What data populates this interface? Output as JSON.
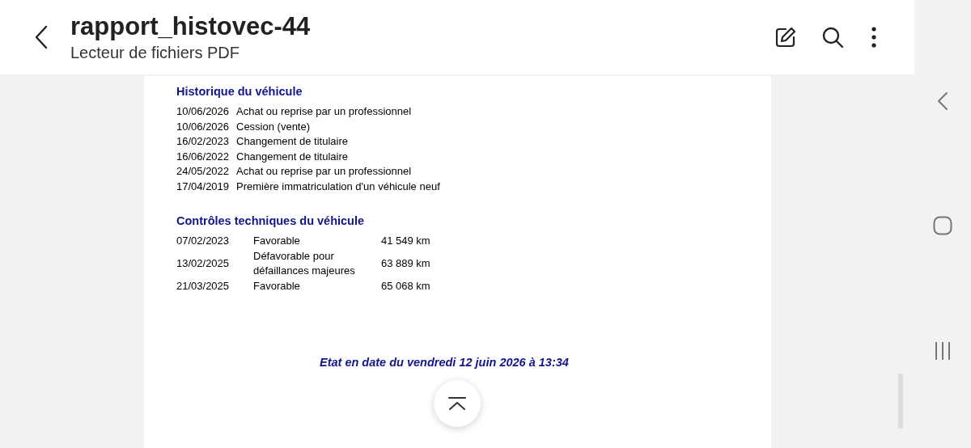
{
  "header": {
    "title": "rapport_histovec-44",
    "subtitle": "Lecteur de fichiers PDF"
  },
  "document": {
    "history": {
      "heading": "Historique du véhicule",
      "rows": [
        {
          "date": "10/06/2026",
          "event": "Achat ou reprise par un professionnel"
        },
        {
          "date": "10/06/2026",
          "event": "Cession (vente)"
        },
        {
          "date": "16/02/2023",
          "event": "Changement de titulaire"
        },
        {
          "date": "16/06/2022",
          "event": "Changement de titulaire"
        },
        {
          "date": "24/05/2022",
          "event": "Achat ou reprise par un professionnel"
        },
        {
          "date": "17/04/2019",
          "event": "Première immatriculation d'un véhicule neuf"
        }
      ]
    },
    "inspections": {
      "heading": "Contrôles techniques du véhicule",
      "rows": [
        {
          "date": "07/02/2023",
          "result": "Favorable",
          "mileage": "41 549 km"
        },
        {
          "date": "13/02/2025",
          "result": "Défavorable pour défaillances majeures",
          "mileage": "63 889 km"
        },
        {
          "date": "21/03/2025",
          "result": "Favorable",
          "mileage": "65 068 km"
        }
      ]
    },
    "footer": "Etat en date du vendredi 12 juin 2026 à 13:34"
  }
}
